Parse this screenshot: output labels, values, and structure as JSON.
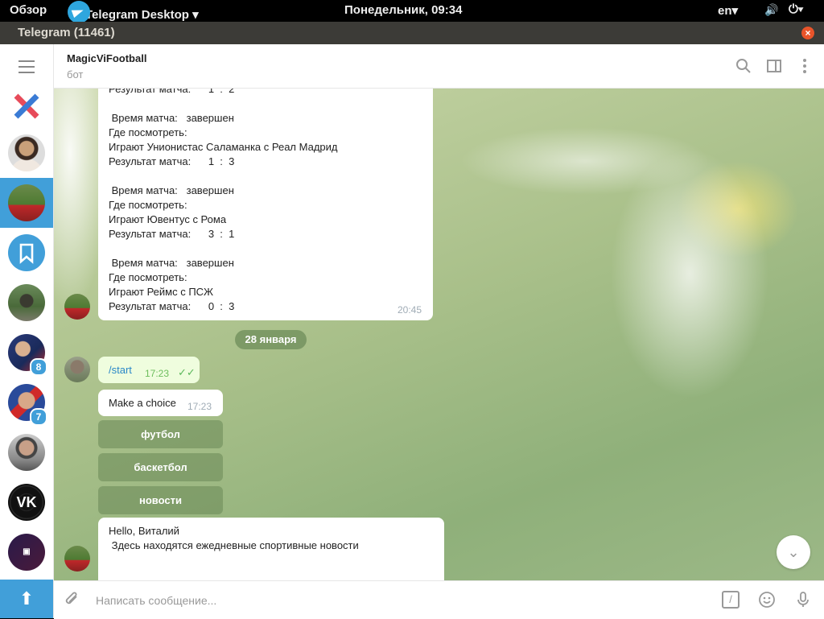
{
  "topbar": {
    "overview": "Обзор",
    "app": "Telegram Desktop ▾",
    "clock": "Понедельник, 09:34",
    "lang": "en▾"
  },
  "window": {
    "title": "Telegram (11461)"
  },
  "sidebar": {
    "badges": [
      "8",
      "7"
    ]
  },
  "chat": {
    "name": "MagicViFootball",
    "status": "бот",
    "message1": {
      "lines": [
        "Результат матча:      1  :  2",
        "",
        " Время матча:   завершен",
        "Где посмотреть:",
        "Играют Унионистас Саламанка с Реал Мадрид",
        "Результат матча:      1  :  3",
        "",
        " Время матча:   завершен",
        "Где посмотреть:",
        "Играют Ювентус с Рома",
        "Результат матча:      3  :  1",
        "",
        " Время матча:   завершен",
        "Где посмотреть:",
        "Играют Реймс с ПСЖ",
        "Результат матча:      0  :  3"
      ],
      "time": "20:45"
    },
    "date_divider": "28 января",
    "outgoing": {
      "text": "/start",
      "time": "17:23",
      "ticks": "✓✓"
    },
    "bot_reply": {
      "text": "Make a choice",
      "time": "17:23"
    },
    "keyboard": [
      "футбол",
      "баскетбол",
      "новости"
    ],
    "message3": {
      "lines": [
        "Hello, Виталий",
        " Здесь находятся ежедневные спортивные новости"
      ]
    }
  },
  "composer": {
    "placeholder": "Написать сообщение..."
  },
  "colors": {
    "accent": "#419fd9",
    "outgoing_bubble": "#effdde"
  }
}
